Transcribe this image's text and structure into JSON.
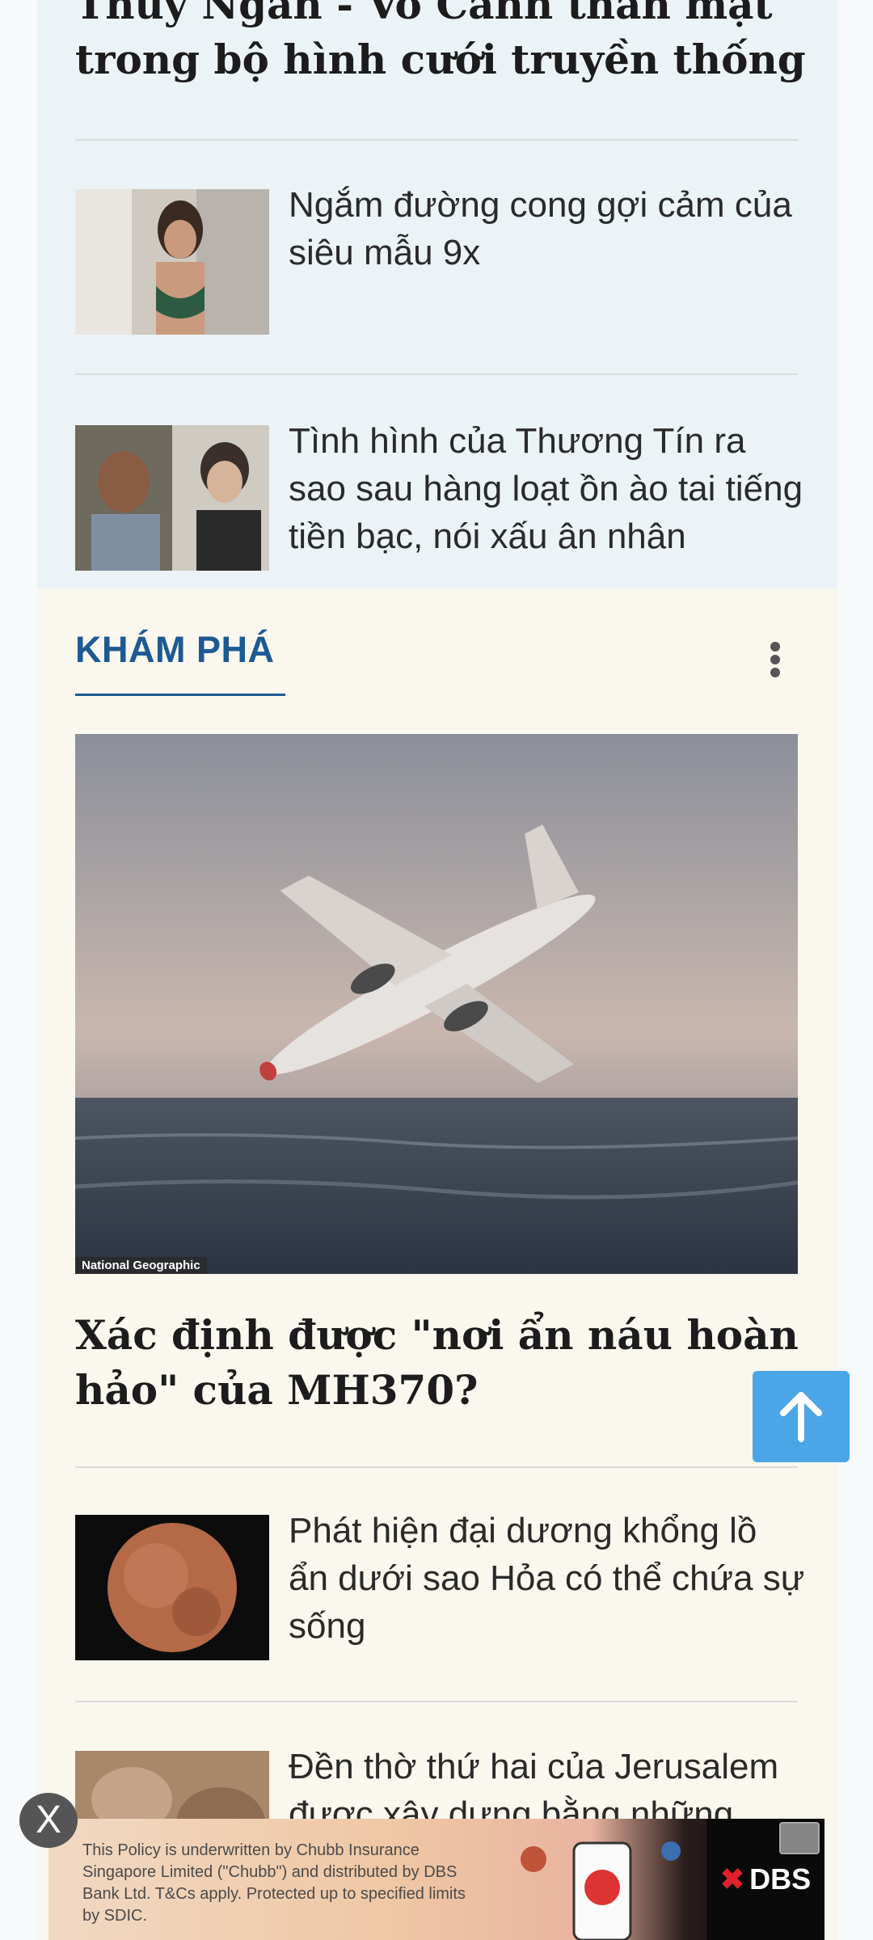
{
  "top_section": {
    "headline": "Thúy Ngân - Võ Cảnh thân mật trong bộ hình cưới truyền thống",
    "items": [
      {
        "title": "Ngắm đường cong gợi cảm của siêu mẫu 9x"
      },
      {
        "title": "Tình hình của Thương Tín ra sao sau hàng loạt ồn ào tai tiếng tiền bạc, nói xấu ân nhân"
      }
    ]
  },
  "explore": {
    "label": "KHÁM PHÁ",
    "hero_credit": "National Geographic",
    "headline": "Xác định được \"nơi ẩn náu hoàn hảo\" của MH370?",
    "items": [
      {
        "title": "Phát hiện đại dương khổng lồ ẩn dưới sao Hỏa có thể chứa sự sống"
      },
      {
        "title": "Đền thờ thứ hai của Jerusalem được xây dựng bằng những"
      }
    ]
  },
  "ad": {
    "text": "This Policy is underwritten by Chubb Insurance Singapore Limited (\"Chubb\") and distributed by DBS Bank Ltd. T&Cs apply. Protected up to specified limits by SDIC.",
    "brand": "DBS"
  },
  "controls": {
    "close_label": "X"
  }
}
